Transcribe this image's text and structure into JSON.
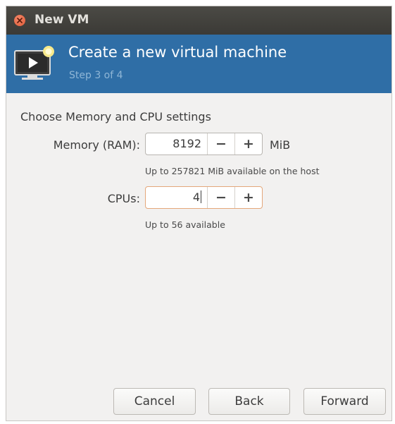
{
  "titlebar": {
    "title": "New VM",
    "close_icon": "close-icon"
  },
  "header": {
    "title": "Create a new virtual machine",
    "step": "Step 3 of 4",
    "icon": "vm-monitor-icon",
    "accent_color": "#2f6ea6"
  },
  "content": {
    "section_title": "Choose Memory and CPU settings",
    "memory": {
      "label": "Memory (RAM):",
      "value": "8192",
      "unit": "MiB",
      "decrement_label": "−",
      "increment_label": "+",
      "hint": "Up to 257821 MiB available on the host"
    },
    "cpus": {
      "label": "CPUs:",
      "value": "4",
      "decrement_label": "−",
      "increment_label": "+",
      "hint": "Up to 56 available"
    }
  },
  "footer": {
    "cancel_label": "Cancel",
    "back_label": "Back",
    "forward_label": "Forward"
  }
}
